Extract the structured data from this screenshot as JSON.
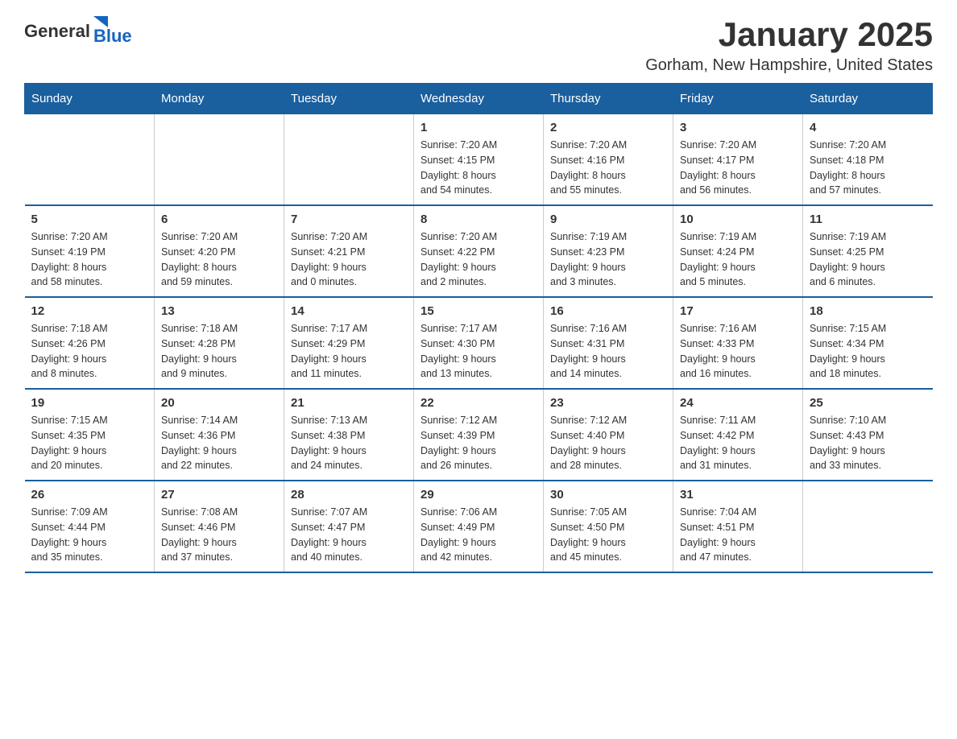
{
  "logo": {
    "general": "General",
    "blue": "Blue"
  },
  "title": "January 2025",
  "subtitle": "Gorham, New Hampshire, United States",
  "weekdays": [
    "Sunday",
    "Monday",
    "Tuesday",
    "Wednesday",
    "Thursday",
    "Friday",
    "Saturday"
  ],
  "weeks": [
    [
      {
        "day": "",
        "info": ""
      },
      {
        "day": "",
        "info": ""
      },
      {
        "day": "",
        "info": ""
      },
      {
        "day": "1",
        "info": "Sunrise: 7:20 AM\nSunset: 4:15 PM\nDaylight: 8 hours\nand 54 minutes."
      },
      {
        "day": "2",
        "info": "Sunrise: 7:20 AM\nSunset: 4:16 PM\nDaylight: 8 hours\nand 55 minutes."
      },
      {
        "day": "3",
        "info": "Sunrise: 7:20 AM\nSunset: 4:17 PM\nDaylight: 8 hours\nand 56 minutes."
      },
      {
        "day": "4",
        "info": "Sunrise: 7:20 AM\nSunset: 4:18 PM\nDaylight: 8 hours\nand 57 minutes."
      }
    ],
    [
      {
        "day": "5",
        "info": "Sunrise: 7:20 AM\nSunset: 4:19 PM\nDaylight: 8 hours\nand 58 minutes."
      },
      {
        "day": "6",
        "info": "Sunrise: 7:20 AM\nSunset: 4:20 PM\nDaylight: 8 hours\nand 59 minutes."
      },
      {
        "day": "7",
        "info": "Sunrise: 7:20 AM\nSunset: 4:21 PM\nDaylight: 9 hours\nand 0 minutes."
      },
      {
        "day": "8",
        "info": "Sunrise: 7:20 AM\nSunset: 4:22 PM\nDaylight: 9 hours\nand 2 minutes."
      },
      {
        "day": "9",
        "info": "Sunrise: 7:19 AM\nSunset: 4:23 PM\nDaylight: 9 hours\nand 3 minutes."
      },
      {
        "day": "10",
        "info": "Sunrise: 7:19 AM\nSunset: 4:24 PM\nDaylight: 9 hours\nand 5 minutes."
      },
      {
        "day": "11",
        "info": "Sunrise: 7:19 AM\nSunset: 4:25 PM\nDaylight: 9 hours\nand 6 minutes."
      }
    ],
    [
      {
        "day": "12",
        "info": "Sunrise: 7:18 AM\nSunset: 4:26 PM\nDaylight: 9 hours\nand 8 minutes."
      },
      {
        "day": "13",
        "info": "Sunrise: 7:18 AM\nSunset: 4:28 PM\nDaylight: 9 hours\nand 9 minutes."
      },
      {
        "day": "14",
        "info": "Sunrise: 7:17 AM\nSunset: 4:29 PM\nDaylight: 9 hours\nand 11 minutes."
      },
      {
        "day": "15",
        "info": "Sunrise: 7:17 AM\nSunset: 4:30 PM\nDaylight: 9 hours\nand 13 minutes."
      },
      {
        "day": "16",
        "info": "Sunrise: 7:16 AM\nSunset: 4:31 PM\nDaylight: 9 hours\nand 14 minutes."
      },
      {
        "day": "17",
        "info": "Sunrise: 7:16 AM\nSunset: 4:33 PM\nDaylight: 9 hours\nand 16 minutes."
      },
      {
        "day": "18",
        "info": "Sunrise: 7:15 AM\nSunset: 4:34 PM\nDaylight: 9 hours\nand 18 minutes."
      }
    ],
    [
      {
        "day": "19",
        "info": "Sunrise: 7:15 AM\nSunset: 4:35 PM\nDaylight: 9 hours\nand 20 minutes."
      },
      {
        "day": "20",
        "info": "Sunrise: 7:14 AM\nSunset: 4:36 PM\nDaylight: 9 hours\nand 22 minutes."
      },
      {
        "day": "21",
        "info": "Sunrise: 7:13 AM\nSunset: 4:38 PM\nDaylight: 9 hours\nand 24 minutes."
      },
      {
        "day": "22",
        "info": "Sunrise: 7:12 AM\nSunset: 4:39 PM\nDaylight: 9 hours\nand 26 minutes."
      },
      {
        "day": "23",
        "info": "Sunrise: 7:12 AM\nSunset: 4:40 PM\nDaylight: 9 hours\nand 28 minutes."
      },
      {
        "day": "24",
        "info": "Sunrise: 7:11 AM\nSunset: 4:42 PM\nDaylight: 9 hours\nand 31 minutes."
      },
      {
        "day": "25",
        "info": "Sunrise: 7:10 AM\nSunset: 4:43 PM\nDaylight: 9 hours\nand 33 minutes."
      }
    ],
    [
      {
        "day": "26",
        "info": "Sunrise: 7:09 AM\nSunset: 4:44 PM\nDaylight: 9 hours\nand 35 minutes."
      },
      {
        "day": "27",
        "info": "Sunrise: 7:08 AM\nSunset: 4:46 PM\nDaylight: 9 hours\nand 37 minutes."
      },
      {
        "day": "28",
        "info": "Sunrise: 7:07 AM\nSunset: 4:47 PM\nDaylight: 9 hours\nand 40 minutes."
      },
      {
        "day": "29",
        "info": "Sunrise: 7:06 AM\nSunset: 4:49 PM\nDaylight: 9 hours\nand 42 minutes."
      },
      {
        "day": "30",
        "info": "Sunrise: 7:05 AM\nSunset: 4:50 PM\nDaylight: 9 hours\nand 45 minutes."
      },
      {
        "day": "31",
        "info": "Sunrise: 7:04 AM\nSunset: 4:51 PM\nDaylight: 9 hours\nand 47 minutes."
      },
      {
        "day": "",
        "info": ""
      }
    ]
  ]
}
